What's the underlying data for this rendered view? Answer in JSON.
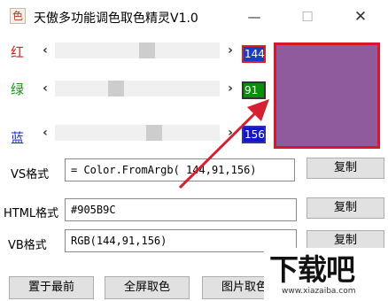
{
  "window": {
    "app_icon_glyph": "色",
    "title": "天傲多功能调色取色精灵V1.0",
    "minimize_glyph": "—",
    "maximize_glyph": "☐",
    "close_glyph": "✕"
  },
  "channels": {
    "red": {
      "label": "红",
      "value": "144",
      "level": 0.565,
      "label_color": "#d42020"
    },
    "green": {
      "label": "绿",
      "value": "91",
      "level": 0.357,
      "label_color": "#109a10"
    },
    "blue": {
      "label": "蓝",
      "value": "156",
      "level": 0.612,
      "label_color": "#1a2ad0"
    }
  },
  "slider_arrows": {
    "left": "‹",
    "right": "›"
  },
  "preview": {
    "color": "#905B9C"
  },
  "formats": {
    "vs": {
      "label": "VS格式",
      "value": " = Color.FromArgb( 144,91,156)",
      "button": "复制"
    },
    "html": {
      "label": "HTML格式",
      "value": "#905B9C",
      "button": "复制"
    },
    "vb": {
      "label": "VB格式",
      "value": "RGB(144,91,156)",
      "button": "复制"
    }
  },
  "bottom_buttons": {
    "topmost": "置于最前",
    "fullscreen_pick": "全屏取色",
    "image_pick": "图片取色"
  },
  "watermark": {
    "big": "下载吧",
    "small": "www.xiazaiba.com"
  },
  "annotation_color": "#d42030"
}
